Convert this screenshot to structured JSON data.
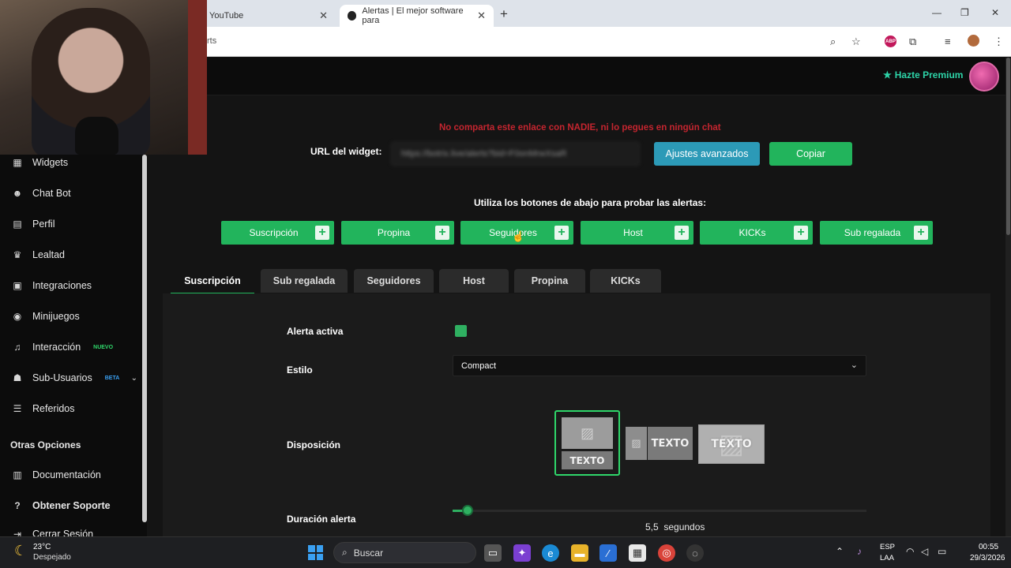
{
  "browser": {
    "tab1_title": "YouTube",
    "tab2_title": "Alertas | El mejor software para",
    "new_tab": "+",
    "url_fragment": "rts",
    "abp_label": "ABP",
    "window_min": "—",
    "window_max": "❐",
    "window_close": "✕"
  },
  "header": {
    "premium_label": "Hazte Premium"
  },
  "sidebar": {
    "items": [
      {
        "label": "Widgets",
        "icon": "grid-icon"
      },
      {
        "label": "Chat Bot",
        "icon": "robot-icon"
      },
      {
        "label": "Perfil",
        "icon": "id-card-icon"
      },
      {
        "label": "Lealtad",
        "icon": "trophy-icon"
      },
      {
        "label": "Integraciones",
        "icon": "puzzle-icon"
      },
      {
        "label": "Minijuegos",
        "icon": "gamepad-icon"
      },
      {
        "label": "Interacción",
        "icon": "music-icon",
        "badge": "NUEVO",
        "badge_color": "#2fd66a"
      },
      {
        "label": "Sub-Usuarios",
        "icon": "users-icon",
        "badge": "BETA",
        "badge_color": "#3aa0f2"
      },
      {
        "label": "Referidos",
        "icon": "user-group-icon"
      }
    ],
    "section_title": "Otras Opciones",
    "other": [
      {
        "label": "Documentación",
        "icon": "book-icon"
      },
      {
        "label": "Obtener Soporte",
        "icon": "question-icon"
      },
      {
        "label": "Cerrar Sesión",
        "icon": "logout-icon"
      }
    ]
  },
  "widget": {
    "warning": "No comparta este enlace con NADIE, ni lo pegues en ningún chat",
    "url_label": "URL del widget:",
    "url_value": "https://botrix.live/alerts?bid=F0onMrwXsaR",
    "advanced_button": "Ajustes avanzados",
    "copy_button": "Copiar",
    "test_label": "Utiliza los botones de abajo para probar las alertas:",
    "test_buttons": [
      "Suscripción",
      "Propina",
      "Seguidores",
      "Host",
      "KICKs",
      "Sub regalada"
    ]
  },
  "tabs": [
    "Suscripción",
    "Sub regalada",
    "Seguidores",
    "Host",
    "Propina",
    "KICKs"
  ],
  "form": {
    "active_label": "Alerta activa",
    "active_value": true,
    "style_label": "Estilo",
    "style_value": "Compact",
    "layout_label": "Disposición",
    "layout_option_text": "TEXTO",
    "duration_label": "Duración alerta",
    "duration_value": "5,5",
    "duration_unit": "segundos"
  },
  "taskbar": {
    "weather_temp": "23°C",
    "weather_desc": "Despejado",
    "search_placeholder": "Buscar",
    "lang1": "ESP",
    "lang2": "LAA",
    "time": "00:55",
    "date": "29/3/2026"
  },
  "colors": {
    "accent_green": "#22b45c",
    "accent_blue": "#2c9ab7",
    "warning_red": "#c4252f",
    "premium": "#2dd4a8"
  }
}
